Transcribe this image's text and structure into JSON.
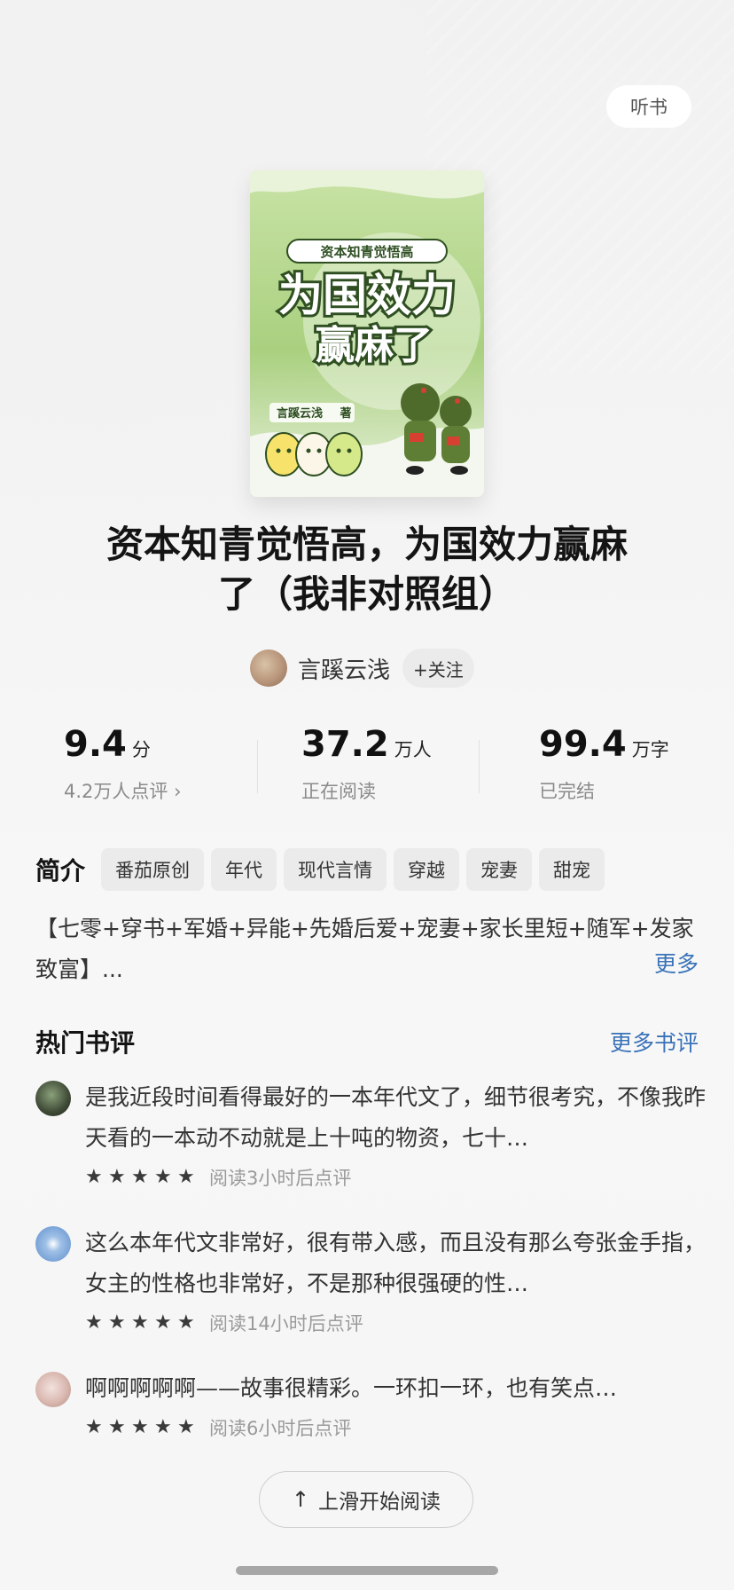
{
  "header": {
    "listen_label": "听书"
  },
  "cover": {
    "series_text": "资本知青觉悟高",
    "title_line1": "为国效力",
    "title_line2": "赢麻了",
    "author_stamp": "言蹊云浅",
    "stamp_suffix": "著"
  },
  "book": {
    "title": "资本知青觉悟高，为国效力赢麻了（我非对照组）"
  },
  "author": {
    "name": "言蹊云浅",
    "follow_label": "+关注"
  },
  "stats": [
    {
      "value": "9.4",
      "unit": "分",
      "sub": "4.2万人点评 ›"
    },
    {
      "value": "37.2",
      "unit": "万人",
      "sub": "正在阅读"
    },
    {
      "value": "99.4",
      "unit": "万字",
      "sub": "已完结"
    }
  ],
  "intro": {
    "label": "简介",
    "tags": [
      "番茄原创",
      "年代",
      "现代言情",
      "穿越",
      "宠妻",
      "甜宠"
    ],
    "text": "【七零+穿书+军婚+异能+先婚后爱+宠妻+家长里短+随军+发家致富】...",
    "more_label": "更多"
  },
  "reviews_section": {
    "title": "热门书评",
    "more_label": "更多书评",
    "items": [
      {
        "text": "是我近段时间看得最好的一本年代文了，细节很考究，不像我昨天看的一本动不动就是上十吨的物资，七十…",
        "meta": "阅读3小时后点评",
        "stars": 5
      },
      {
        "text": "这么本年代文非常好，很有带入感，而且没有那么夸张金手指，女主的性格也非常好，不是那种很强硬的性…",
        "meta": "阅读14小时后点评",
        "stars": 5
      },
      {
        "text": "啊啊啊啊啊——故事很精彩。一环扣一环，也有笑点…",
        "meta": "阅读6小时后点评",
        "stars": 5
      }
    ]
  },
  "footer": {
    "start_label": "上滑开始阅读"
  },
  "colors": {
    "link": "#3a73b8",
    "cover_green": "#a9d07f"
  }
}
